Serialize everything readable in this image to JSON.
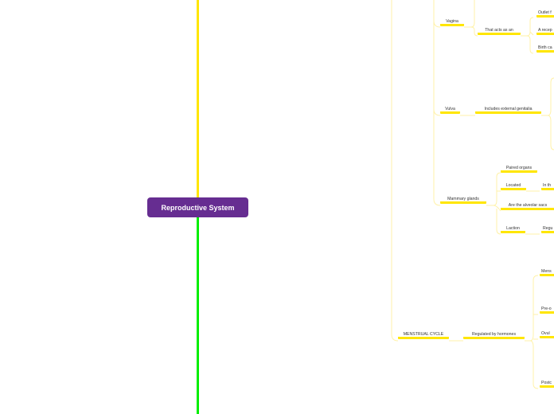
{
  "root": {
    "label": "Reproductive System"
  },
  "colors": {
    "root_fill": "#662d91",
    "branch_upper": "#ffe600",
    "branch_lower": "#00ee00",
    "underline": "#ffe600",
    "connector": "#fff2a8"
  },
  "nodes": {
    "vagina": "Vagina",
    "that_acts_as_an": "That acts as an",
    "outlet": "Outlet f",
    "receptacle": "A recep",
    "birth_canal": "Birth ca",
    "vulva": "Vulva",
    "includes_external_genitalia": "Includes external genitalia",
    "mammary_glands": "Mammary glands",
    "paired_organs": "Paired organs",
    "located": "Located",
    "located_in": "In th",
    "alveolar_sacs": "Are the alveolar sacs",
    "laction": "Laction",
    "laction_regulated": "Regu",
    "menstrual_cycle": "MENSTRUAL CYCLE",
    "regulated_by_hormones": "Regulated by hormones",
    "mens": "Mens",
    "pre": "Pre-o",
    "ovul": "Ovul",
    "post": "Postc"
  }
}
